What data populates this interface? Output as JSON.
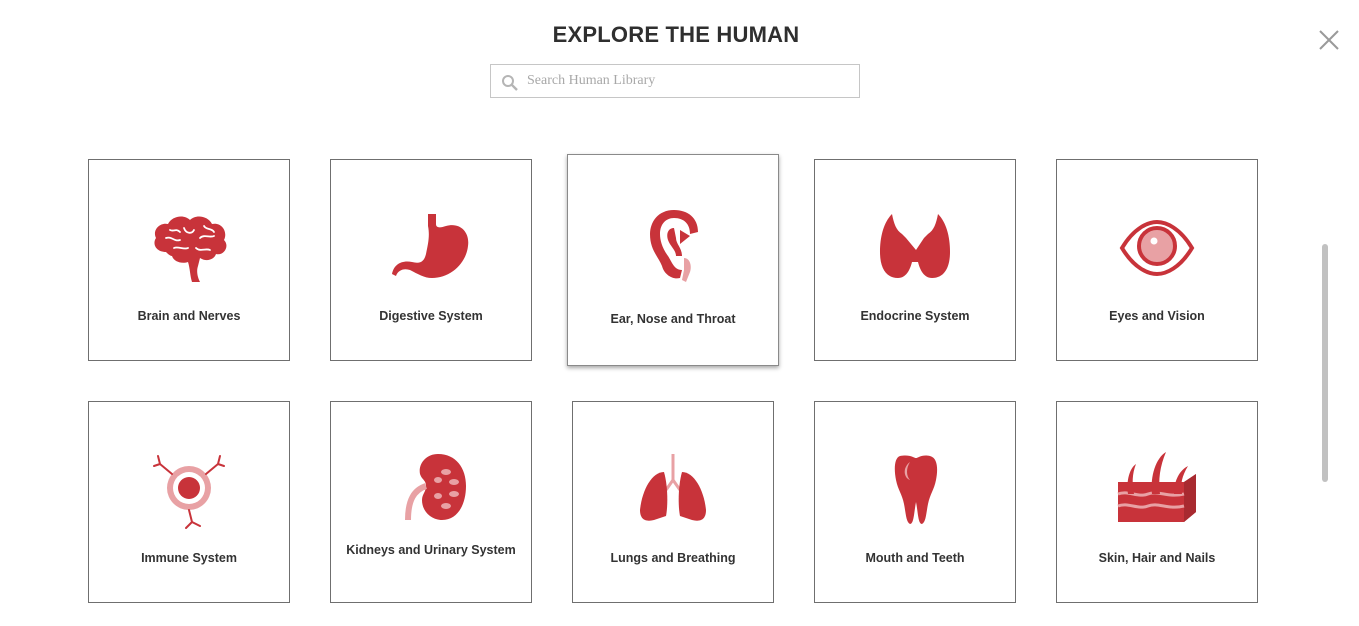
{
  "header": {
    "title": "EXPLORE THE HUMAN",
    "close_icon": "close-icon"
  },
  "search": {
    "placeholder": "Search Human Library",
    "value": "",
    "icon": "search-icon"
  },
  "colors": {
    "accent": "#c8333a",
    "accent_light": "#e8a1a4"
  },
  "cards": [
    {
      "label": "Brain and Nerves",
      "icon": "brain-icon"
    },
    {
      "label": "Digestive System",
      "icon": "stomach-icon"
    },
    {
      "label": "Ear, Nose and Throat",
      "icon": "ear-icon"
    },
    {
      "label": "Endocrine System",
      "icon": "thyroid-icon"
    },
    {
      "label": "Eyes and Vision",
      "icon": "eye-icon"
    },
    {
      "label": "Immune System",
      "icon": "immune-cell-icon"
    },
    {
      "label": "Kidneys and Urinary System",
      "icon": "kidney-icon"
    },
    {
      "label": "Lungs and Breathing",
      "icon": "lungs-icon"
    },
    {
      "label": "Mouth and Teeth",
      "icon": "tooth-icon"
    },
    {
      "label": "Skin, Hair and Nails",
      "icon": "skin-icon"
    }
  ]
}
